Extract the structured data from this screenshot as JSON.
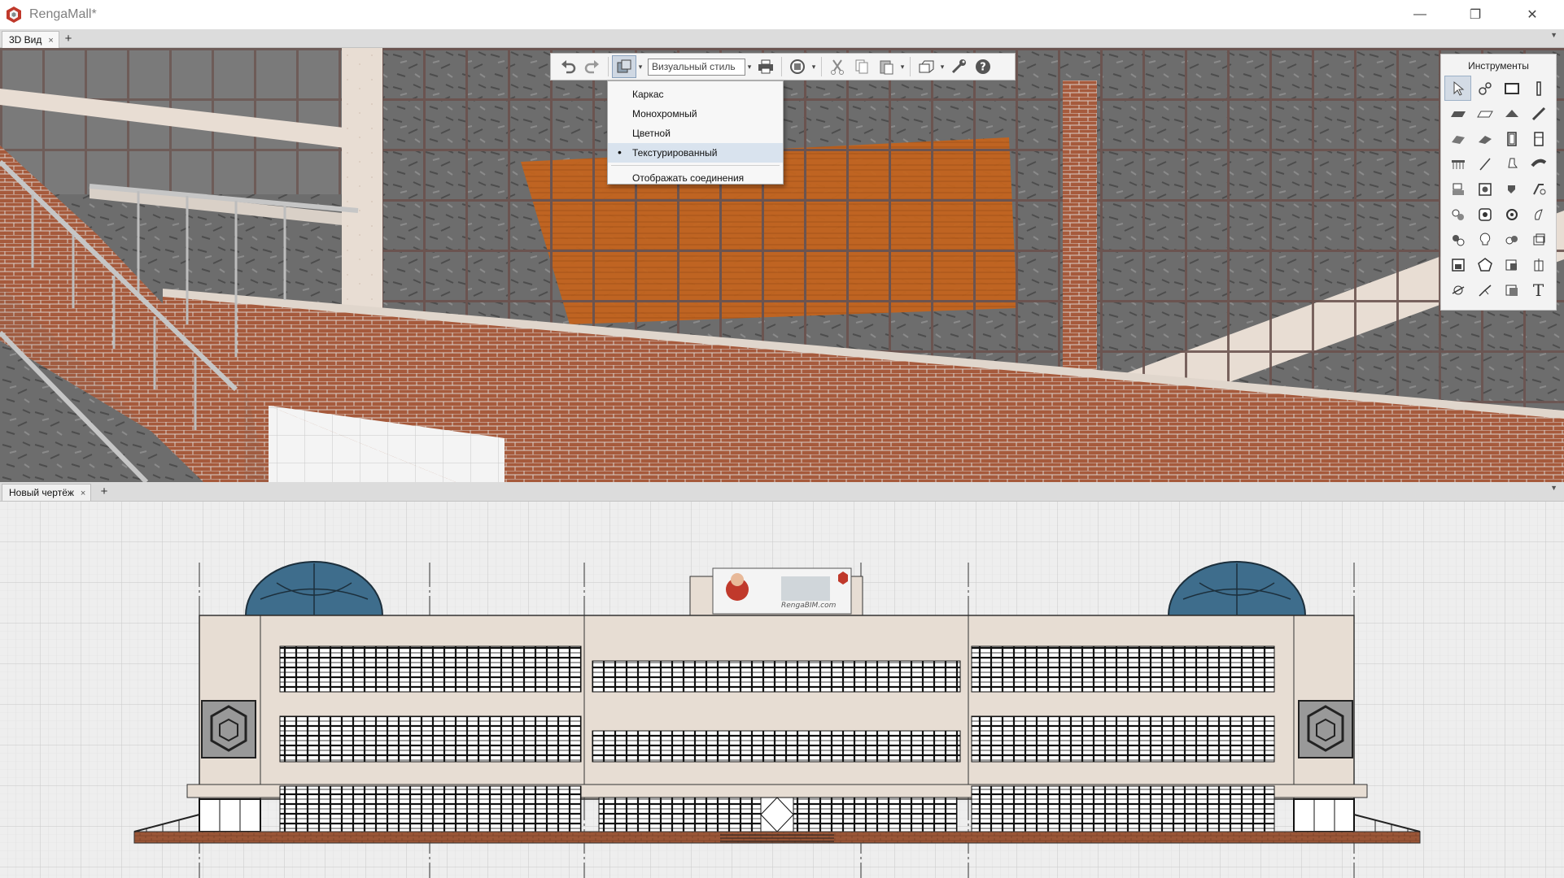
{
  "window": {
    "title": "RengaMall*",
    "minimize_glyph": "—",
    "restore_glyph": "❐",
    "close_glyph": "✕"
  },
  "top_tabs": {
    "tabs": [
      {
        "label": "3D Вид",
        "close": "×"
      }
    ],
    "add": "+",
    "menu": "▼"
  },
  "toolbar": {
    "visual_style_value": "Визуальный стиль",
    "icons": [
      "undo-icon",
      "redo-icon",
      "visual-style-icon",
      "print-icon",
      "orbit-icon",
      "cut-icon",
      "copy-icon",
      "paste-icon",
      "view-cube-icon",
      "settings-icon",
      "help-icon"
    ],
    "arrow": "▾"
  },
  "visual_style_menu": {
    "items": [
      {
        "label": "Каркас",
        "selected": false
      },
      {
        "label": "Монохромный",
        "selected": false
      },
      {
        "label": "Цветной",
        "selected": false
      },
      {
        "label": "Текстурированный",
        "selected": true
      }
    ],
    "bullet": "•",
    "extra_item": "Отображать соединения"
  },
  "tools_panel": {
    "title": "Инструменты",
    "tools": [
      "select-tool-icon",
      "axes-tool-icon",
      "wall-tool-icon",
      "column-tool-icon",
      "slab-tool-icon",
      "floor-tool-icon",
      "roof-tool-icon",
      "beam-tool-icon",
      "stair-tool-icon",
      "ramp-tool-icon",
      "door-tool-icon",
      "window-tool-icon",
      "railing-tool-icon",
      "line-tool-icon",
      "equipment-tool-icon",
      "pipe-tool-icon",
      "room-tool-icon",
      "opening-tool-icon",
      "plumbing-tool-icon",
      "duct-tool-icon",
      "fixture-tool-icon",
      "mechanical-tool-icon",
      "fitting-tool-icon",
      "accessory-tool-icon",
      "electrical-tool-icon",
      "lamp-tool-icon",
      "switch-tool-icon",
      "panel-tool-icon",
      "assembly-tool-icon",
      "element-tool-icon",
      "rebar-tool-icon",
      "reinforcement-tool-icon",
      "dimension-tool-icon",
      "leader-tool-icon",
      "hatch-tool-icon",
      "text-tool-icon"
    ],
    "text_tool_glyph": "T"
  },
  "bottom_tabs": {
    "tabs": [
      {
        "label": "Новый чертёж",
        "close": "×"
      }
    ],
    "add": "+",
    "menu": "▼"
  },
  "colors": {
    "brick": "#a65a3c",
    "wall_plaster": "#e7ddd3",
    "frame": "#6b5450",
    "concrete": "#6f6f6f",
    "wood": "#c3641e",
    "dome": "#3e6d8c",
    "accent": "#cfd8e3"
  },
  "drawing": {
    "banner_logo_text": "RengaBIM.com"
  }
}
